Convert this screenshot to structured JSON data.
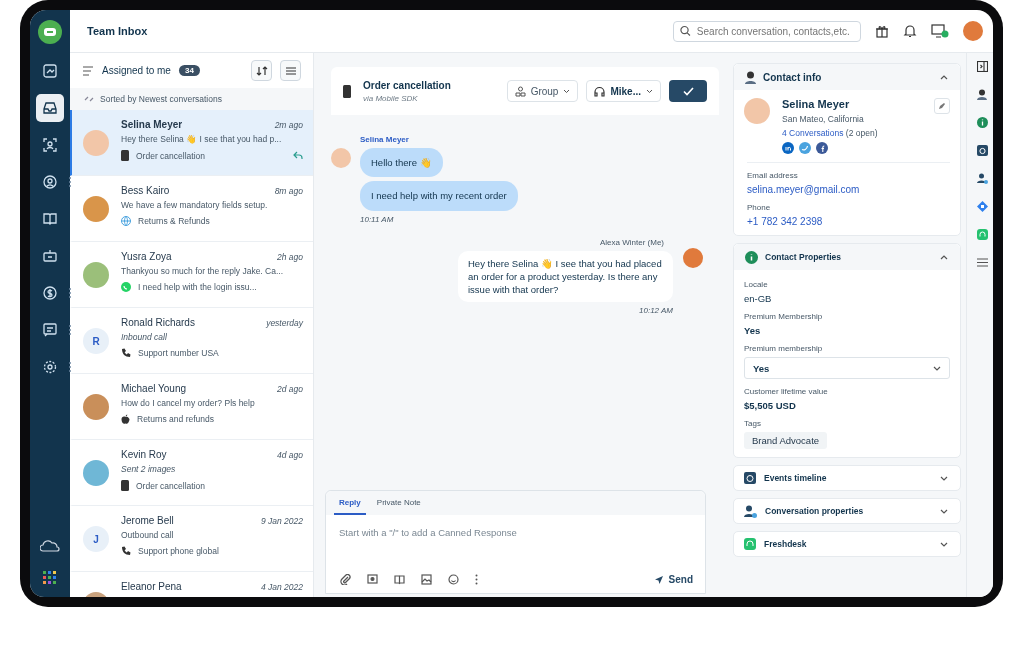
{
  "window": {
    "title": "Team Inbox"
  },
  "search": {
    "placeholder": "Search conversation, contacts,etc."
  },
  "nav": [
    {
      "selected": false,
      "more": false
    },
    {
      "selected": true,
      "more": false
    },
    {
      "selected": false,
      "more": false
    },
    {
      "selected": false,
      "more": true
    },
    {
      "selected": false,
      "more": false
    },
    {
      "selected": false,
      "more": false
    },
    {
      "selected": false,
      "more": true
    },
    {
      "selected": false,
      "more": true
    },
    {
      "selected": false,
      "more": true
    }
  ],
  "list": {
    "filter": "Assigned to me",
    "count": "34",
    "sort_note": "Sorted by Newest conversations",
    "items": [
      {
        "name": "Selina Meyer",
        "time": "2m ago",
        "preview": "Hey there Selina 👋 I see that you had p...",
        "italic": false,
        "kind": "mobile",
        "topic": "Order cancellation",
        "replied": true,
        "selected": true
      },
      {
        "name": "Bess Kairo",
        "time": "8m ago",
        "preview": "We have a few mandatory fields setup.",
        "italic": false,
        "kind": "web",
        "topic": "Returns & Refunds",
        "replied": false,
        "selected": false
      },
      {
        "name": "Yusra Zoya",
        "time": "2h ago",
        "preview": "Thankyou so much for the reply Jake. Ca...",
        "italic": false,
        "kind": "whatsapp",
        "topic": "I need help with the login issu...",
        "replied": false,
        "selected": false
      },
      {
        "name": "Ronald Richards",
        "time": "yesterday",
        "preview": "Inbound call",
        "italic": true,
        "kind": "phone",
        "topic": "Support number USA",
        "initial": "R",
        "replied": false,
        "selected": false
      },
      {
        "name": "Michael Young",
        "time": "2d ago",
        "preview": "How do I cancel my order? Pls help",
        "italic": false,
        "kind": "apple",
        "topic": "Returns and refunds",
        "replied": false,
        "selected": false
      },
      {
        "name": "Kevin Roy",
        "time": "4d ago",
        "preview": "Sent 2 images",
        "italic": true,
        "kind": "mobile",
        "topic": "Order cancellation",
        "replied": false,
        "selected": false
      },
      {
        "name": "Jerome Bell",
        "time": "9 Jan 2022",
        "preview": "Outbound call",
        "italic": false,
        "kind": "phone",
        "topic": "Support phone global",
        "initial": "J",
        "replied": false,
        "selected": false
      },
      {
        "name": "Eleanor Pena",
        "time": "4 Jan 2022",
        "selected": false
      }
    ]
  },
  "conversation": {
    "title": "Order cancellation",
    "via": "via Mobile SDK",
    "group": "Group",
    "agent": "Mike...",
    "messages": [
      {
        "kind": "incoming",
        "author": "Selina Meyer",
        "bubbles": [
          "Hello there 👋",
          "I need help with my recent order"
        ],
        "time": "10:11 AM"
      },
      {
        "kind": "outgoing",
        "author": "Alexa Winter (Me)",
        "bubbles": [
          "Hey there Selina 👋 I see that you had placed an order for a product yesterday. Is there any issue with that order?"
        ],
        "time": "10:12 AM"
      }
    ],
    "composer": {
      "tabs": [
        {
          "label": "Reply",
          "selected": true
        },
        {
          "label": "Private Note",
          "selected": false
        }
      ],
      "placeholder": "Start with a \"/\" to add a Canned Response",
      "send": "Send"
    }
  },
  "contact": {
    "title": "Contact info",
    "name": "Selina Meyer",
    "location": "San Mateo, California",
    "conversations": "4 Conversations",
    "open": "(2 open)",
    "fields": [
      {
        "label": "Email address",
        "value": "selina.meyer@gmail.com"
      },
      {
        "label": "Phone",
        "value": "+1 782 342 2398"
      }
    ]
  },
  "properties": {
    "title": "Contact Properties",
    "locale_label": "Locale",
    "locale": "en-GB",
    "membership_label": "Premium Membership",
    "membership": "Yes",
    "select_label": "Premium membership",
    "select_value": "Yes",
    "ltv_label": "Customer lifetime value",
    "ltv": "$5,505 USD",
    "tags_label": "Tags",
    "tags": [
      "Brand Advocate"
    ]
  },
  "sections": [
    {
      "title": "Events timeline",
      "kind": "timeline"
    },
    {
      "title": "Conversation properties",
      "kind": "person"
    },
    {
      "title": "Freshdesk",
      "kind": "freshdesk"
    }
  ]
}
